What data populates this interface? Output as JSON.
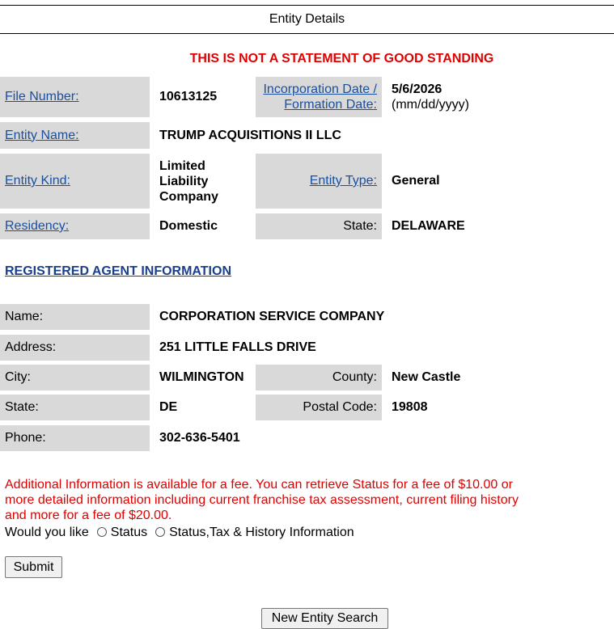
{
  "page": {
    "title": "Entity Details",
    "warning": "THIS IS NOT A STATEMENT OF GOOD STANDING"
  },
  "entity": {
    "file_number_label": "File Number:",
    "file_number": "10613125",
    "inc_date_label_line1": "Incorporation Date /",
    "inc_date_label_line2": "Formation Date:",
    "inc_date": "5/6/2026",
    "inc_date_format": "(mm/dd/yyyy)",
    "name_label": "Entity Name:",
    "name": "TRUMP ACQUISITIONS II LLC",
    "kind_label": "Entity Kind:",
    "kind_line1": "Limited",
    "kind_line2": "Liability",
    "kind_line3": "Company",
    "type_label": "Entity Type:",
    "type": "General",
    "residency_label": "Residency:",
    "residency": "Domestic",
    "state_label": "State:",
    "state": "DELAWARE"
  },
  "agent": {
    "section_title": "REGISTERED AGENT INFORMATION",
    "name_label": "Name:",
    "name": "CORPORATION SERVICE COMPANY",
    "address_label": "Address:",
    "address": "251 LITTLE FALLS DRIVE",
    "city_label": "City:",
    "city": "WILMINGTON",
    "county_label": "County:",
    "county": "New Castle",
    "state_label": "State:",
    "state": "DE",
    "postal_label": "Postal Code:",
    "postal": "19808",
    "phone_label": "Phone:",
    "phone": "302-636-5401"
  },
  "additional": {
    "info_line1": "Additional Information is available for a fee. You can retrieve Status for a fee of $10.00 or",
    "info_line2": "more detailed information including current franchise tax assessment, current filing history",
    "info_line3": "and more for a fee of $20.00.",
    "prompt": "Would you like",
    "option_status": "Status",
    "option_full": "Status,Tax & History Information",
    "submit_label": "Submit",
    "new_search_label": "New Entity Search"
  }
}
